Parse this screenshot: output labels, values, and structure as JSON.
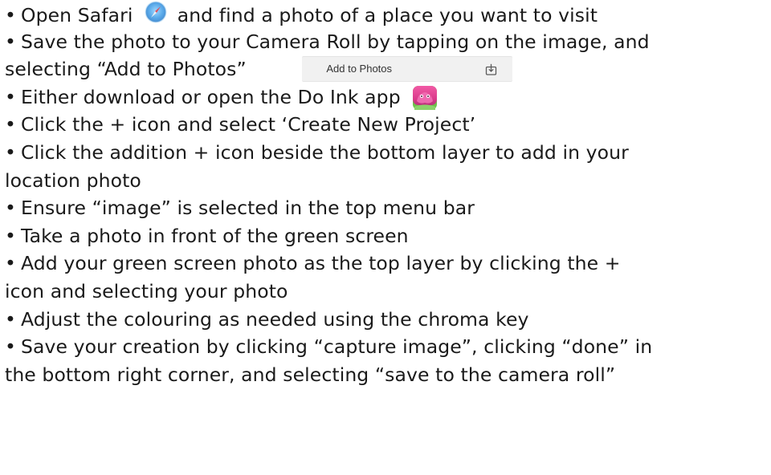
{
  "bullet": "•",
  "steps": {
    "s1_before": "Open Safari",
    "s1_after": "and find a photo of a place you want to visit",
    "s2_line1": "Save the photo to your Camera Roll by tapping on the image, and",
    "s2_line2": "selecting “Add to Photos”",
    "s2_menu_item": "Add to Photos",
    "s3": "Either download or open the Do Ink app",
    "s4": "Click the + icon and select ‘Create New Project’",
    "s5_line1": "Click the addition + icon beside the bottom layer to add in your",
    "s5_line2": "location photo",
    "s6": "Ensure “image” is selected in the top menu bar",
    "s7": "Take a photo in front of the green screen",
    "s8_line1": "Add your green screen photo as the top layer by clicking the +",
    "s8_line2": "icon and selecting your photo",
    "s9": "Adjust the colouring as needed using the chroma key",
    "s10_line1": "Save your creation by clicking “capture image”, clicking “done” in",
    "s10_line2": "the bottom right corner, and selecting “save to the camera roll”"
  },
  "icons": {
    "safari": "safari-icon",
    "doink": "do-ink-app-icon",
    "share": "share-icon"
  },
  "colors": {
    "text": "#1a1a1a",
    "safari_blue": "#2f8ee0",
    "doink_pink": "#e0418f",
    "doink_green": "#5cb84a",
    "menu_bg": "#f1f1f1"
  }
}
